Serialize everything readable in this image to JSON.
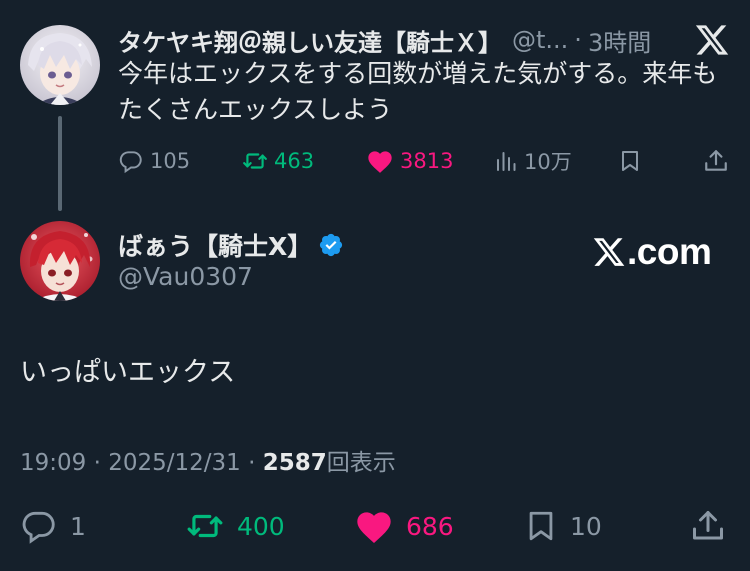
{
  "colors": {
    "background": "#15202b",
    "text_primary": "#e7e9ea",
    "text_secondary": "#8b98a5",
    "retweet_green": "#00ba7c",
    "like_pink": "#f91880",
    "verified_blue": "#1d9bf0"
  },
  "parent_tweet": {
    "display_name": "タケヤキ翔＠親しい友達【騎士Ｘ】",
    "handle": "@t...",
    "separator": "·",
    "time": "3時間",
    "text": "今年はエックスをする回数が増えた気がする。来年もたくさんエックスしよう",
    "replies": "105",
    "retweets": "463",
    "likes": "3813",
    "views": "10万",
    "icons": [
      "avatar",
      "x-logo-icon",
      "reply-icon",
      "retweet-icon",
      "heart-filled-icon",
      "views-icon",
      "bookmark-icon",
      "share-icon"
    ]
  },
  "main_tweet": {
    "display_name": "ばぁう【騎士X】",
    "handle": "@Vau0307",
    "watermark": ".com",
    "text": "いっぱいエックス",
    "time": "19:09",
    "separator": "·",
    "date": "2025/12/31",
    "separator2": "·",
    "view_count": "2587",
    "view_label": "回表示",
    "replies": "1",
    "retweets": "400",
    "likes": "686",
    "bookmarks": "10",
    "icons": [
      "avatar",
      "verified-badge-icon",
      "x-logo-icon",
      "reply-icon",
      "retweet-icon",
      "heart-filled-icon",
      "bookmark-icon",
      "share-icon"
    ]
  }
}
